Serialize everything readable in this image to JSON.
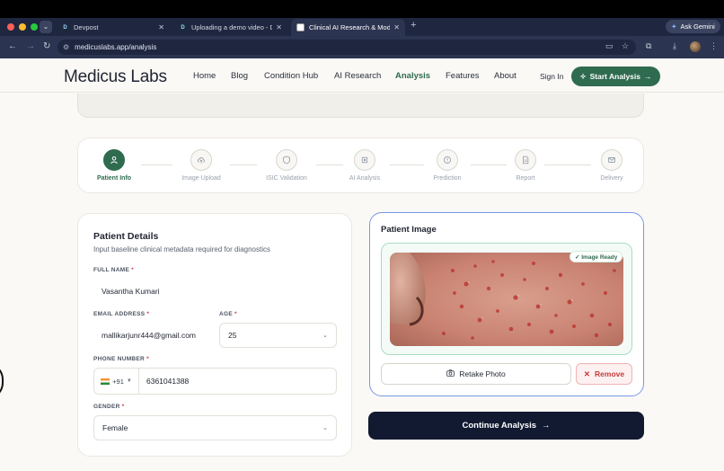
{
  "browser": {
    "tabs": [
      {
        "favicon": "D",
        "title": "Devpost",
        "active": false
      },
      {
        "favicon": "D",
        "title": "Uploading a demo video - Dev",
        "active": false
      },
      {
        "favicon": "",
        "title": "Clinical AI Research & Model",
        "active": true
      }
    ],
    "url": "medicuslabs.app/analysis",
    "gemini_label": "Ask Gemini",
    "colors": {
      "traffic_red": "#ff5f57",
      "traffic_yellow": "#febc2e",
      "traffic_green": "#28c840"
    }
  },
  "site": {
    "logo": "Medicus Labs",
    "nav": [
      "Home",
      "Blog",
      "Condition Hub",
      "AI Research",
      "Analysis",
      "Features",
      "About"
    ],
    "active_nav": "Analysis",
    "sign_in": "Sign In",
    "start_analysis": "Start Analysis",
    "accent": "#2f6b4f"
  },
  "stepper": {
    "steps": [
      {
        "label": "Patient Info",
        "icon": "user-icon",
        "active": true
      },
      {
        "label": "Image Upload",
        "icon": "upload-cloud-icon",
        "active": false
      },
      {
        "label": "ISIC Validation",
        "icon": "shield-icon",
        "active": false
      },
      {
        "label": "AI Analysis",
        "icon": "chip-icon",
        "active": false
      },
      {
        "label": "Prediction",
        "icon": "target-icon",
        "active": false
      },
      {
        "label": "Report",
        "icon": "document-icon",
        "active": false
      },
      {
        "label": "Delivery",
        "icon": "mail-icon",
        "active": false
      }
    ]
  },
  "details": {
    "title": "Patient Details",
    "subtitle": "Input baseline clinical metadata required for diagnostics",
    "full_name_label": "FULL NAME",
    "full_name": "Vasantha Kumari",
    "email_label": "EMAIL ADDRESS",
    "email": "mallikarjunr444@gmail.com",
    "age_label": "AGE",
    "age": "25",
    "phone_label": "PHONE NUMBER",
    "country_code": "+91",
    "phone": "6361041388",
    "gender_label": "GENDER",
    "gender": "Female",
    "required_mark": "*"
  },
  "image_panel": {
    "title": "Patient Image",
    "badge": "✓ Image Ready",
    "retake": "Retake Photo",
    "remove": "Remove"
  },
  "continue_label": "Continue Analysis"
}
